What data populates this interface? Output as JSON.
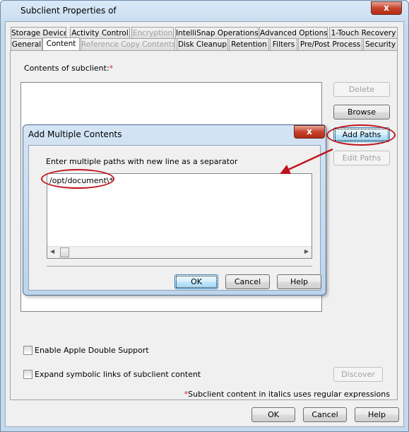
{
  "window": {
    "title": "Subclient Properties of",
    "close": "x"
  },
  "tabs_row1": [
    {
      "label": "Storage Device"
    },
    {
      "label": "Activity Control"
    },
    {
      "label": "Encryption",
      "disabled": true
    },
    {
      "label": "IntelliSnap Operations"
    },
    {
      "label": "Advanced Options"
    },
    {
      "label": "1-Touch Recovery"
    }
  ],
  "tabs_row2": [
    {
      "label": "General"
    },
    {
      "label": "Content",
      "selected": true
    },
    {
      "label": "Reference Copy Contents",
      "disabled": true
    },
    {
      "label": "Disk Cleanup"
    },
    {
      "label": "Retention"
    },
    {
      "label": "Filters"
    },
    {
      "label": "Pre/Post Process"
    },
    {
      "label": "Security"
    }
  ],
  "content": {
    "label": "Contents of subclient:",
    "required_mark": "*",
    "buttons": {
      "delete": "Delete",
      "browse": "Browse",
      "add_paths": "Add Paths",
      "edit_paths": "Edit Paths",
      "discover": "Discover"
    },
    "apple_double": {
      "label": "Enable Apple Double Support",
      "checked": false
    },
    "symlinks": {
      "label": "Expand symbolic links of subclient content",
      "checked": false
    },
    "note_mark": "*",
    "note": "Subclient content in italics uses regular expressions"
  },
  "dialog": {
    "title": "Add Multiple Contents",
    "close": "x",
    "instruction": "Enter multiple paths with new line as a separator",
    "paths_value": "/opt/document\\*",
    "ok": "OK",
    "cancel": "Cancel",
    "help": "Help"
  },
  "footer": {
    "ok": "OK",
    "cancel": "Cancel",
    "help": "Help"
  },
  "colors": {
    "annotation": "#c0141c",
    "required": "#e02020"
  }
}
